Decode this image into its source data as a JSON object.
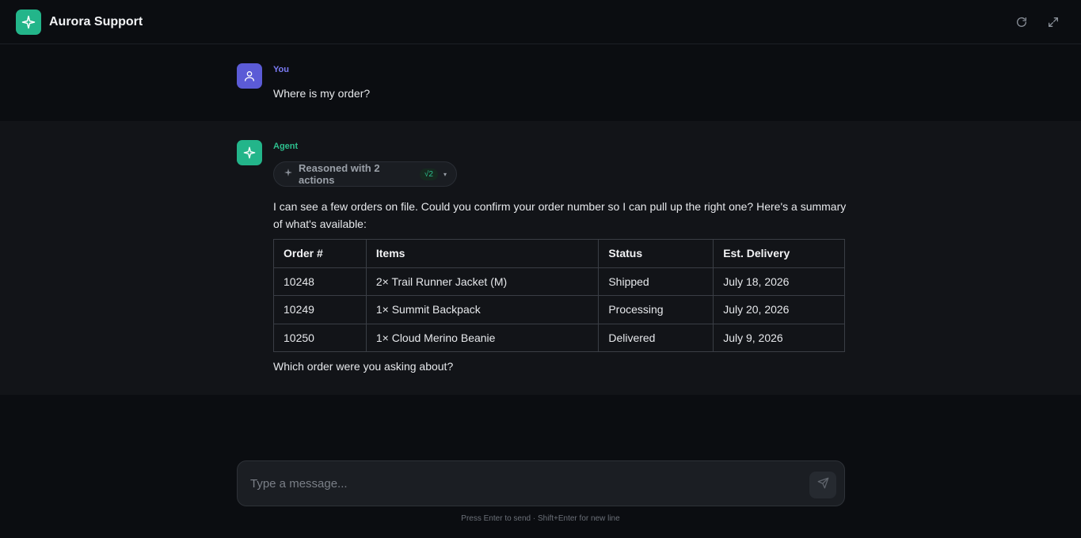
{
  "header": {
    "title": "Aurora Support",
    "icons": [
      "sparkle-icon",
      "refresh-icon",
      "expand-icon"
    ]
  },
  "messages": {
    "user": {
      "sender": "You",
      "text": "Where is my order?"
    },
    "agent": {
      "sender": "Agent",
      "reasoning": {
        "label": "Reasoned with 2 actions",
        "badge": "√2"
      },
      "intro": "I can see a few orders on file. Could you confirm your order number so I can pull up the right one? Here's a summary of what's available:",
      "table": {
        "headers": [
          "Order #",
          "Items",
          "Status",
          "Est. Delivery"
        ],
        "rows": [
          [
            "10248",
            "2× Trail Runner Jacket (M)",
            "Shipped",
            "July 18, 2026"
          ],
          [
            "10249",
            "1× Summit Backpack",
            "Processing",
            "July 20, 2026"
          ],
          [
            "10250",
            "1× Cloud Merino Beanie",
            "Delivered",
            "July 9, 2026"
          ]
        ]
      },
      "outro": "Which order were you asking about?"
    }
  },
  "composer": {
    "placeholder": "Type a message...",
    "value": "",
    "hint": "Press Enter to send · Shift+Enter for new line"
  },
  "colors": {
    "background": "#0b0d11",
    "agent_band": "#121418",
    "brand": "#23b58a",
    "user_accent": "#5b5bd6"
  }
}
